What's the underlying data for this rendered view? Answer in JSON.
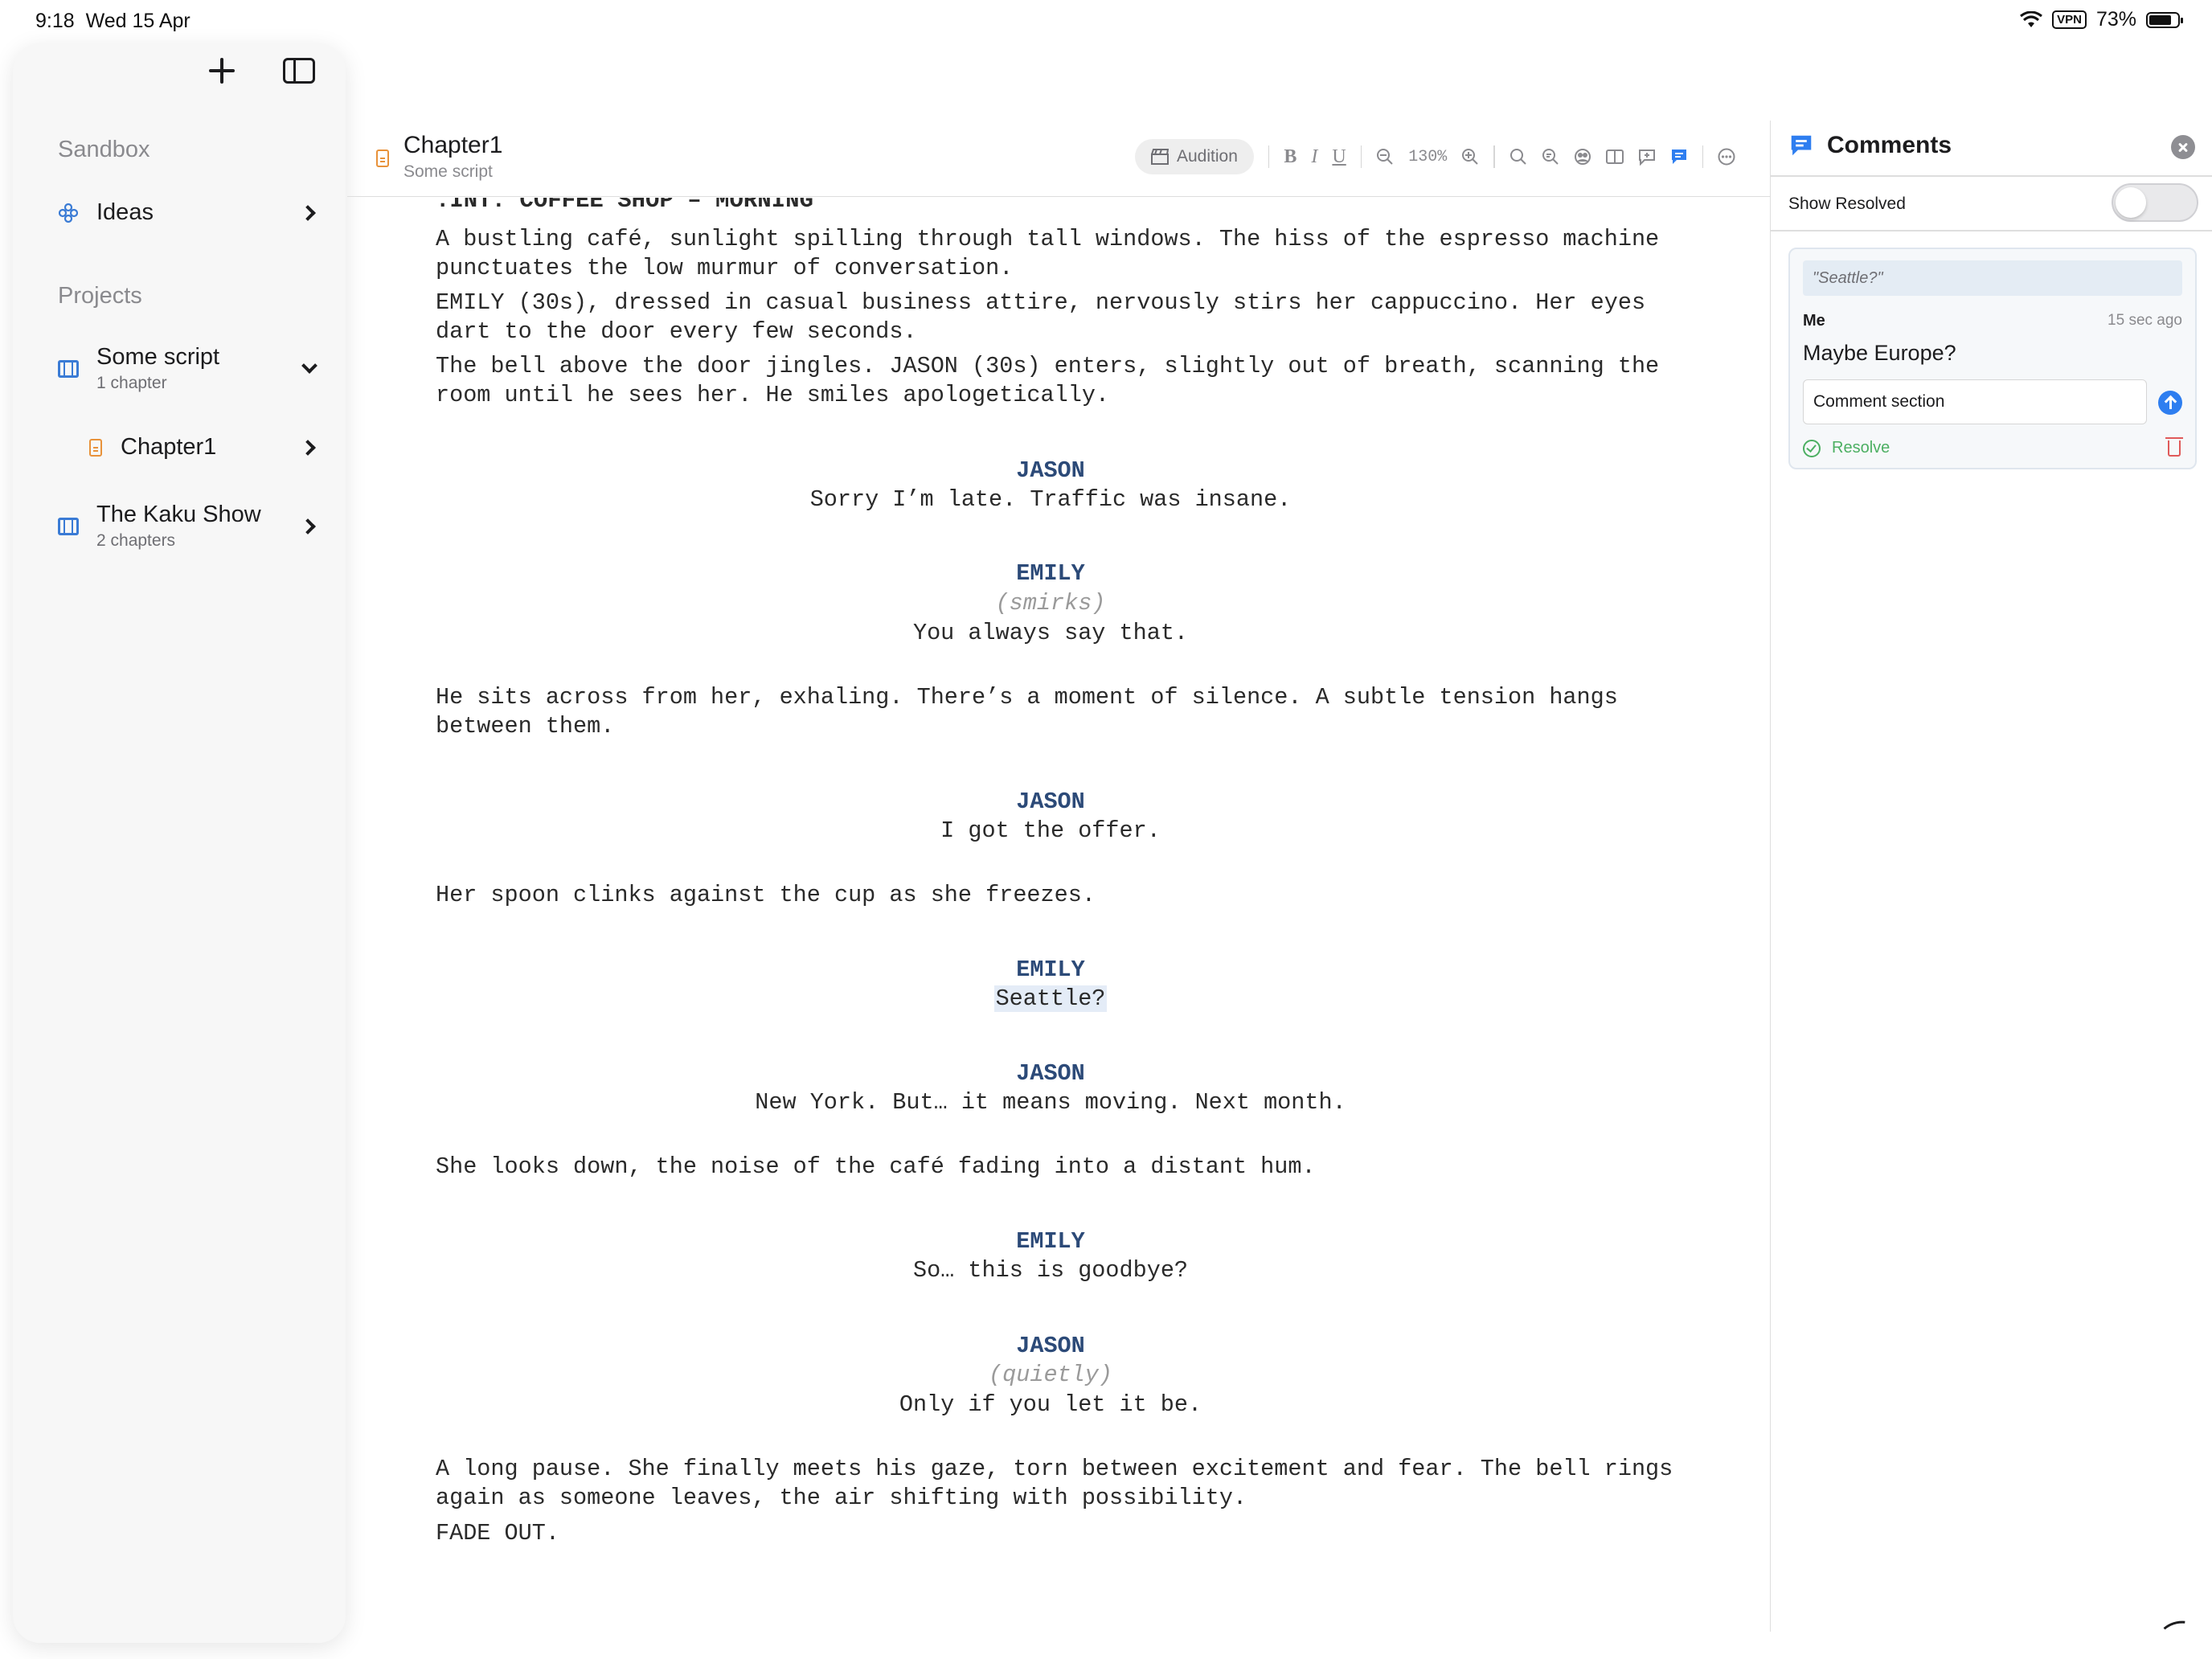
{
  "status_bar": {
    "time": "9:18",
    "date": "Wed 15 Apr",
    "vpn": "VPN",
    "battery": "73%"
  },
  "sidebar": {
    "icons": {
      "new": "plus-icon",
      "toggle": "sidebar-toggle-icon"
    },
    "sandbox_title": "Sandbox",
    "ideas_label": "Ideas",
    "projects_title": "Projects",
    "projects": [
      {
        "name": "Some script",
        "sub": "1 chapter"
      },
      {
        "name": "The Kaku Show",
        "sub": "2 chapters"
      }
    ],
    "chapter_label": "Chapter1"
  },
  "editor": {
    "title": "Chapter1",
    "subtitle": "Some script",
    "toolbar": {
      "audition": "Audition",
      "bold": "B",
      "italic": "I",
      "underline": "U",
      "zoom": "130%"
    }
  },
  "script": {
    "scene_heading": ".INT. COFFEE SHOP – MORNING",
    "lines": [
      "A bustling café, sunlight spilling through tall windows. The hiss of the espresso machine punctuates the low murmur of conversation.",
      "EMILY (30s), dressed in casual business attire, nervously stirs her cappuccino. Her eyes dart to the door every few seconds.",
      "The bell above the door jingles. JASON (30s) enters, slightly out of breath, scanning the room until he sees her. He smiles apologetically.",
      "JASON",
      "Sorry I’m late. Traffic was insane.",
      "EMILY",
      "(smirks)",
      "You always say that.",
      "He sits across from her, exhaling. There’s a moment of silence. A subtle tension hangs between them.",
      "JASON",
      "I got the offer.",
      "Her spoon clinks against the cup as she freezes.",
      "EMILY",
      "Seattle?",
      "JASON",
      "New York. But… it means moving. Next month.",
      "She looks down, the noise of the café fading into a distant hum.",
      "EMILY",
      "So… this is goodbye?",
      "JASON",
      "(quietly)",
      "Only if you let it be.",
      "A long pause. She finally meets his gaze, torn between excitement and fear. The bell rings again as someone leaves, the air shifting with possibility.",
      "FADE OUT."
    ]
  },
  "comments": {
    "title": "Comments",
    "show_resolved": "Show Resolved",
    "show_resolved_on": false,
    "items": [
      {
        "quote": "\"Seattle?\"",
        "author": "Me",
        "time": "15 sec ago",
        "text": "Maybe Europe?",
        "reply_value": "Comment section",
        "resolve_label": "Resolve"
      }
    ]
  },
  "colors": {
    "accent": "#2e7ef0",
    "character": "#2c4a78",
    "resolve": "#4caf62",
    "delete": "#e05a5a"
  }
}
